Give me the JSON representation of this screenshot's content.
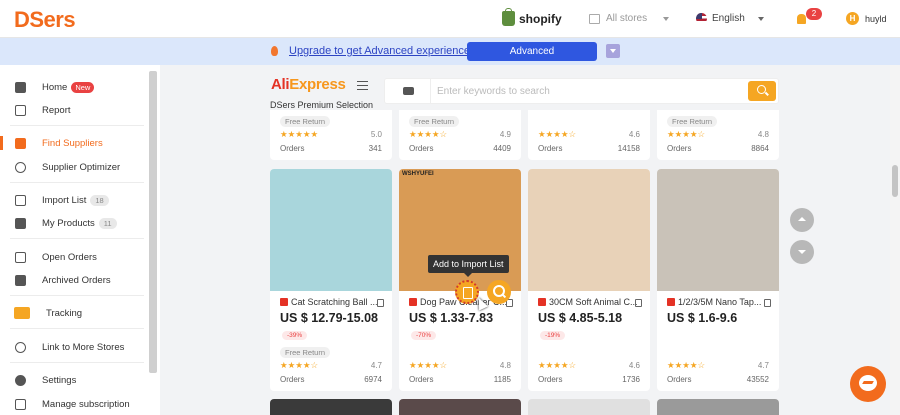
{
  "topbar": {
    "logo": "DSers",
    "shopify_label": "shopify",
    "stores_label": "All stores",
    "language": "English",
    "notification_count": "2",
    "avatar_initial": "H",
    "username": "huyld"
  },
  "banner": {
    "upgrade_link": "Upgrade to get Advanced experience.",
    "advanced_button": "Advanced"
  },
  "sidebar": {
    "home": "Home",
    "home_badge": "New",
    "report": "Report",
    "find_suppliers": "Find Suppliers",
    "supplier_optimizer": "Supplier Optimizer",
    "import_list": "Import List",
    "import_list_count": "18",
    "my_products": "My Products",
    "my_products_count": "11",
    "open_orders": "Open Orders",
    "archived_orders": "Archived Orders",
    "tracking": "Tracking",
    "link_more_stores": "Link to More Stores",
    "settings": "Settings",
    "manage_subscription": "Manage subscription"
  },
  "main": {
    "ae_logo_a": "Ali",
    "ae_logo_b": "Express",
    "premium_title": "DSers Premium Selection",
    "search_placeholder": "Enter keywords to search",
    "tooltip": "Add to Import List",
    "orders_label": "Orders",
    "free_return": "Free Return"
  },
  "top_row": [
    {
      "free_return": true,
      "stars": "★★★★★",
      "rating": "5.0",
      "orders": "341"
    },
    {
      "free_return": true,
      "stars": "★★★★☆",
      "rating": "4.9",
      "orders": "4409"
    },
    {
      "free_return": false,
      "stars": "★★★★☆",
      "rating": "4.6",
      "orders": "14158"
    },
    {
      "free_return": true,
      "stars": "★★★★☆",
      "rating": "4.8",
      "orders": "8864"
    }
  ],
  "products": [
    {
      "title": "Cat Scratching Ball ...",
      "price": "US $ 12.79-15.08",
      "discount": "-39%",
      "free_return": true,
      "stars": "★★★★☆",
      "rating": "4.7",
      "orders": "6974",
      "image_color": "#a9d6dc"
    },
    {
      "title": "Dog Paw Cleaner C...",
      "price": "US $ 1.33-7.83",
      "discount": "-70%",
      "free_return": false,
      "stars": "★★★★☆",
      "rating": "4.8",
      "orders": "1185",
      "image_color": "#d99b55",
      "image_text": "WSHYUFEI"
    },
    {
      "title": "30CM Soft Animal C...",
      "price": "US $ 4.85-5.18",
      "discount": "-19%",
      "free_return": false,
      "stars": "★★★★☆",
      "rating": "4.6",
      "orders": "1736",
      "image_color": "#e8d2b8"
    },
    {
      "title": "1/2/3/5M Nano Tap...",
      "price": "US $ 1.6-9.6",
      "discount": "",
      "free_return": false,
      "stars": "★★★★☆",
      "rating": "4.7",
      "orders": "43552",
      "image_color": "#c9c2b8"
    }
  ],
  "colors": {
    "brand_orange": "#f26b1d",
    "accent_yellow": "#f5a623",
    "advanced_blue": "#2f57e0",
    "banner_bg": "#dbe7fb"
  }
}
